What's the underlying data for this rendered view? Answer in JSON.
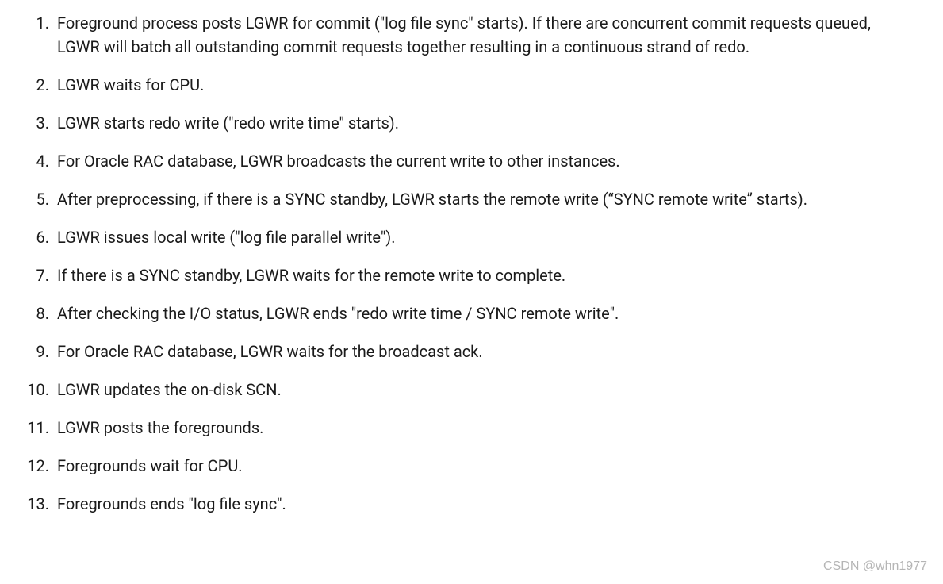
{
  "list": {
    "items": [
      "Foreground process posts LGWR for commit (\"log file sync\" starts). If there are concurrent commit requests queued, LGWR will batch all outstanding commit requests together resulting in a continuous strand of redo.",
      "LGWR waits for CPU.",
      "LGWR starts redo write (\"redo write time\" starts).",
      "For Oracle RAC database, LGWR broadcasts the current write to other instances.",
      "After preprocessing, if there is a SYNC standby, LGWR starts the remote write (“SYNC remote write” starts).",
      "LGWR issues local write (\"log file parallel write\").",
      "If there is a SYNC standby, LGWR waits for the remote write to complete.",
      "After checking the I/O status, LGWR ends \"redo write time / SYNC remote write\".",
      "For Oracle RAC database, LGWR waits for the broadcast ack.",
      "LGWR updates the on-disk SCN.",
      "LGWR posts the foregrounds.",
      "Foregrounds wait for CPU.",
      "Foregrounds ends \"log file sync\"."
    ]
  },
  "watermark": "CSDN @whn1977"
}
